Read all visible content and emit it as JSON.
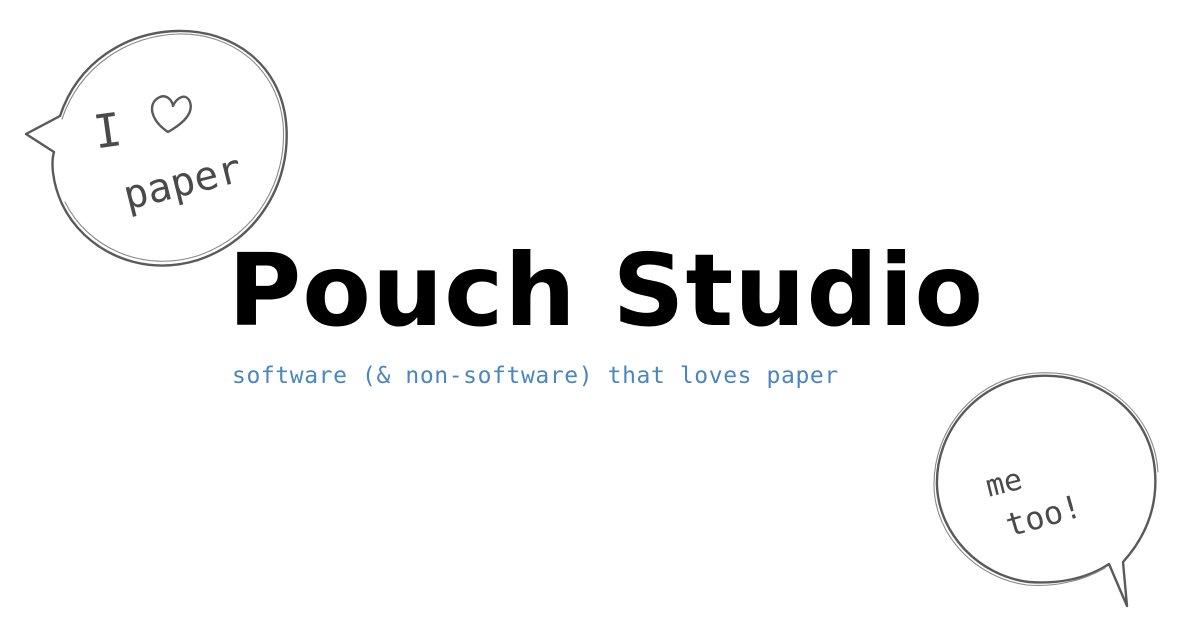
{
  "brand": {
    "title": "Pouch Studio",
    "tagline": "software (& non-software) that loves paper"
  },
  "bubbles": {
    "left": {
      "line1": "I",
      "line2": "paper",
      "icon": "heart-icon"
    },
    "right": {
      "line1": "me",
      "line2": "too!"
    }
  },
  "colors": {
    "background": "#ffffff",
    "title": "#000000",
    "tagline": "#4a86c0",
    "sketch": "#5a5a5a"
  }
}
